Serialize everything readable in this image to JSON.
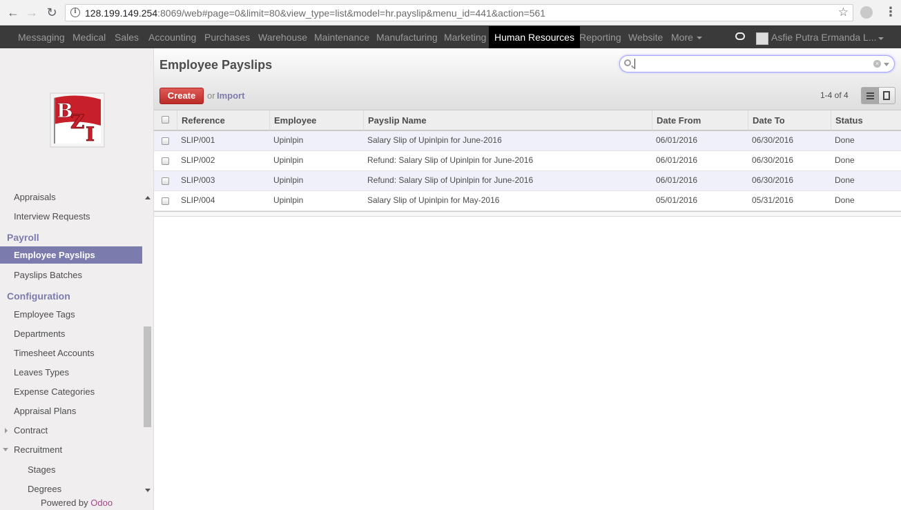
{
  "browser": {
    "url_host": "128.199.149.254",
    "url_rest": ":8069/web#page=0&limit=80&view_type=list&model=hr.payslip&menu_id=441&action=561"
  },
  "topmenu": {
    "items": [
      "Messaging",
      "Medical",
      "Sales",
      "Accounting",
      "Purchases",
      "Warehouse",
      "Maintenance",
      "Manufacturing",
      "Marketing",
      "Human Resources",
      "Reporting",
      "Website",
      "More"
    ],
    "active": "Human Resources",
    "user": "Asfie Putra Ermanda L..."
  },
  "logo": {
    "text": "BZI",
    "color": "#c8202a"
  },
  "sidebar": {
    "items": {
      "appraisals": "Appraisals",
      "interview_requests": "Interview Requests",
      "payroll": "Payroll",
      "employee_payslips": "Employee Payslips",
      "payslips_batches": "Payslips Batches",
      "configuration": "Configuration",
      "employee_tags": "Employee Tags",
      "departments": "Departments",
      "timesheet_accounts": "Timesheet Accounts",
      "leaves_types": "Leaves Types",
      "expense_categories": "Expense Categories",
      "appraisal_plans": "Appraisal Plans",
      "contract": "Contract",
      "recruitment": "Recruitment",
      "stages": "Stages",
      "degrees": "Degrees"
    },
    "powered_prefix": "Powered by",
    "powered_brand": "Odoo"
  },
  "main": {
    "title": "Employee Payslips",
    "create_label": "Create",
    "or_label": "or",
    "import_label": "Import",
    "pager": "1-4 of 4",
    "columns": [
      "Reference",
      "Employee",
      "Payslip Name",
      "Date From",
      "Date To",
      "Status"
    ],
    "rows": [
      [
        "SLIP/001",
        "Upinlpin",
        "Salary Slip of Upinlpin for June-2016",
        "06/01/2016",
        "06/30/2016",
        "Done"
      ],
      [
        "SLIP/002",
        "Upinlpin",
        "Refund: Salary Slip of Upinlpin for June-2016",
        "06/01/2016",
        "06/30/2016",
        "Done"
      ],
      [
        "SLIP/003",
        "Upinlpin",
        "Refund: Salary Slip of Upinlpin for June-2016",
        "06/01/2016",
        "06/30/2016",
        "Done"
      ],
      [
        "SLIP/004",
        "Upinlpin",
        "Salary Slip of Upinlpin for May-2016",
        "05/01/2016",
        "05/31/2016",
        "Done"
      ]
    ]
  },
  "colors": {
    "accent": "#7c7bad",
    "create": "#c9302c",
    "menubar": "#3a3a3a"
  }
}
